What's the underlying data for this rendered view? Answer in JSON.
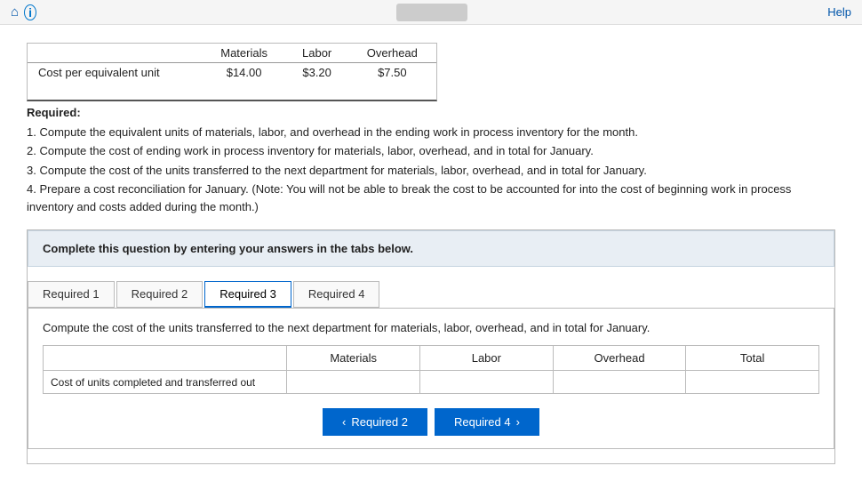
{
  "topbar": {
    "help_label": "Help"
  },
  "cost_table": {
    "headers": [
      "Materials",
      "Labor",
      "Overhead"
    ],
    "row_label": "Cost per equivalent unit",
    "values": [
      "$14.00",
      "$3.20",
      "$7.50"
    ]
  },
  "required_section": {
    "title": "Required:",
    "items": [
      "1. Compute the equivalent units of materials, labor, and overhead in the ending work in process inventory for the month.",
      "2. Compute the cost of ending work in process inventory for materials, labor, overhead, and in total for January.",
      "3. Compute the cost of the units transferred to the next department for materials, labor, overhead, and in total for January.",
      "4. Prepare a cost reconciliation for January. (Note: You will not be able to break the cost to be accounted for into the cost of beginning work in process inventory and costs added during the month.)"
    ]
  },
  "info_box": {
    "text": "Complete this question by entering your answers in the tabs below."
  },
  "tabs": [
    {
      "label": "Required 1",
      "active": false
    },
    {
      "label": "Required 2",
      "active": false
    },
    {
      "label": "Required 3",
      "active": true
    },
    {
      "label": "Required 4",
      "active": false
    }
  ],
  "tab_content": {
    "description": "Compute the cost of the units transferred to the next department for materials, labor, overhead, and in total for January."
  },
  "table": {
    "headers": [
      "Materials",
      "Labor",
      "Overhead",
      "Total"
    ],
    "rows": [
      {
        "label": "Cost of units completed and transferred out",
        "materials": "",
        "labor": "",
        "overhead": "",
        "total": ""
      }
    ]
  },
  "nav_buttons": {
    "prev_label": "Required 2",
    "next_label": "Required 4"
  }
}
